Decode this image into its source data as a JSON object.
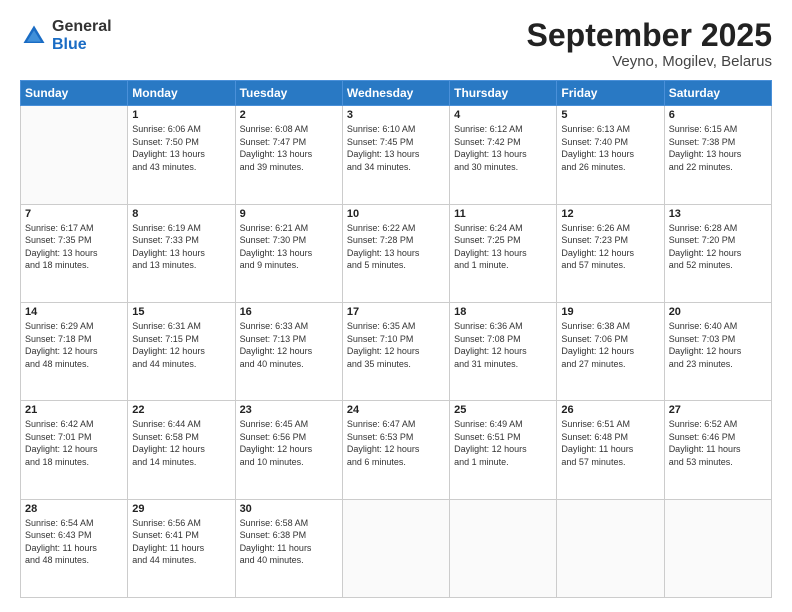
{
  "header": {
    "logo_general": "General",
    "logo_blue": "Blue",
    "title": "September 2025",
    "location": "Veyno, Mogilev, Belarus"
  },
  "weekdays": [
    "Sunday",
    "Monday",
    "Tuesday",
    "Wednesday",
    "Thursday",
    "Friday",
    "Saturday"
  ],
  "weeks": [
    [
      {
        "day": "",
        "info": ""
      },
      {
        "day": "1",
        "info": "Sunrise: 6:06 AM\nSunset: 7:50 PM\nDaylight: 13 hours\nand 43 minutes."
      },
      {
        "day": "2",
        "info": "Sunrise: 6:08 AM\nSunset: 7:47 PM\nDaylight: 13 hours\nand 39 minutes."
      },
      {
        "day": "3",
        "info": "Sunrise: 6:10 AM\nSunset: 7:45 PM\nDaylight: 13 hours\nand 34 minutes."
      },
      {
        "day": "4",
        "info": "Sunrise: 6:12 AM\nSunset: 7:42 PM\nDaylight: 13 hours\nand 30 minutes."
      },
      {
        "day": "5",
        "info": "Sunrise: 6:13 AM\nSunset: 7:40 PM\nDaylight: 13 hours\nand 26 minutes."
      },
      {
        "day": "6",
        "info": "Sunrise: 6:15 AM\nSunset: 7:38 PM\nDaylight: 13 hours\nand 22 minutes."
      }
    ],
    [
      {
        "day": "7",
        "info": "Sunrise: 6:17 AM\nSunset: 7:35 PM\nDaylight: 13 hours\nand 18 minutes."
      },
      {
        "day": "8",
        "info": "Sunrise: 6:19 AM\nSunset: 7:33 PM\nDaylight: 13 hours\nand 13 minutes."
      },
      {
        "day": "9",
        "info": "Sunrise: 6:21 AM\nSunset: 7:30 PM\nDaylight: 13 hours\nand 9 minutes."
      },
      {
        "day": "10",
        "info": "Sunrise: 6:22 AM\nSunset: 7:28 PM\nDaylight: 13 hours\nand 5 minutes."
      },
      {
        "day": "11",
        "info": "Sunrise: 6:24 AM\nSunset: 7:25 PM\nDaylight: 13 hours\nand 1 minute."
      },
      {
        "day": "12",
        "info": "Sunrise: 6:26 AM\nSunset: 7:23 PM\nDaylight: 12 hours\nand 57 minutes."
      },
      {
        "day": "13",
        "info": "Sunrise: 6:28 AM\nSunset: 7:20 PM\nDaylight: 12 hours\nand 52 minutes."
      }
    ],
    [
      {
        "day": "14",
        "info": "Sunrise: 6:29 AM\nSunset: 7:18 PM\nDaylight: 12 hours\nand 48 minutes."
      },
      {
        "day": "15",
        "info": "Sunrise: 6:31 AM\nSunset: 7:15 PM\nDaylight: 12 hours\nand 44 minutes."
      },
      {
        "day": "16",
        "info": "Sunrise: 6:33 AM\nSunset: 7:13 PM\nDaylight: 12 hours\nand 40 minutes."
      },
      {
        "day": "17",
        "info": "Sunrise: 6:35 AM\nSunset: 7:10 PM\nDaylight: 12 hours\nand 35 minutes."
      },
      {
        "day": "18",
        "info": "Sunrise: 6:36 AM\nSunset: 7:08 PM\nDaylight: 12 hours\nand 31 minutes."
      },
      {
        "day": "19",
        "info": "Sunrise: 6:38 AM\nSunset: 7:06 PM\nDaylight: 12 hours\nand 27 minutes."
      },
      {
        "day": "20",
        "info": "Sunrise: 6:40 AM\nSunset: 7:03 PM\nDaylight: 12 hours\nand 23 minutes."
      }
    ],
    [
      {
        "day": "21",
        "info": "Sunrise: 6:42 AM\nSunset: 7:01 PM\nDaylight: 12 hours\nand 18 minutes."
      },
      {
        "day": "22",
        "info": "Sunrise: 6:44 AM\nSunset: 6:58 PM\nDaylight: 12 hours\nand 14 minutes."
      },
      {
        "day": "23",
        "info": "Sunrise: 6:45 AM\nSunset: 6:56 PM\nDaylight: 12 hours\nand 10 minutes."
      },
      {
        "day": "24",
        "info": "Sunrise: 6:47 AM\nSunset: 6:53 PM\nDaylight: 12 hours\nand 6 minutes."
      },
      {
        "day": "25",
        "info": "Sunrise: 6:49 AM\nSunset: 6:51 PM\nDaylight: 12 hours\nand 1 minute."
      },
      {
        "day": "26",
        "info": "Sunrise: 6:51 AM\nSunset: 6:48 PM\nDaylight: 11 hours\nand 57 minutes."
      },
      {
        "day": "27",
        "info": "Sunrise: 6:52 AM\nSunset: 6:46 PM\nDaylight: 11 hours\nand 53 minutes."
      }
    ],
    [
      {
        "day": "28",
        "info": "Sunrise: 6:54 AM\nSunset: 6:43 PM\nDaylight: 11 hours\nand 48 minutes."
      },
      {
        "day": "29",
        "info": "Sunrise: 6:56 AM\nSunset: 6:41 PM\nDaylight: 11 hours\nand 44 minutes."
      },
      {
        "day": "30",
        "info": "Sunrise: 6:58 AM\nSunset: 6:38 PM\nDaylight: 11 hours\nand 40 minutes."
      },
      {
        "day": "",
        "info": ""
      },
      {
        "day": "",
        "info": ""
      },
      {
        "day": "",
        "info": ""
      },
      {
        "day": "",
        "info": ""
      }
    ]
  ]
}
